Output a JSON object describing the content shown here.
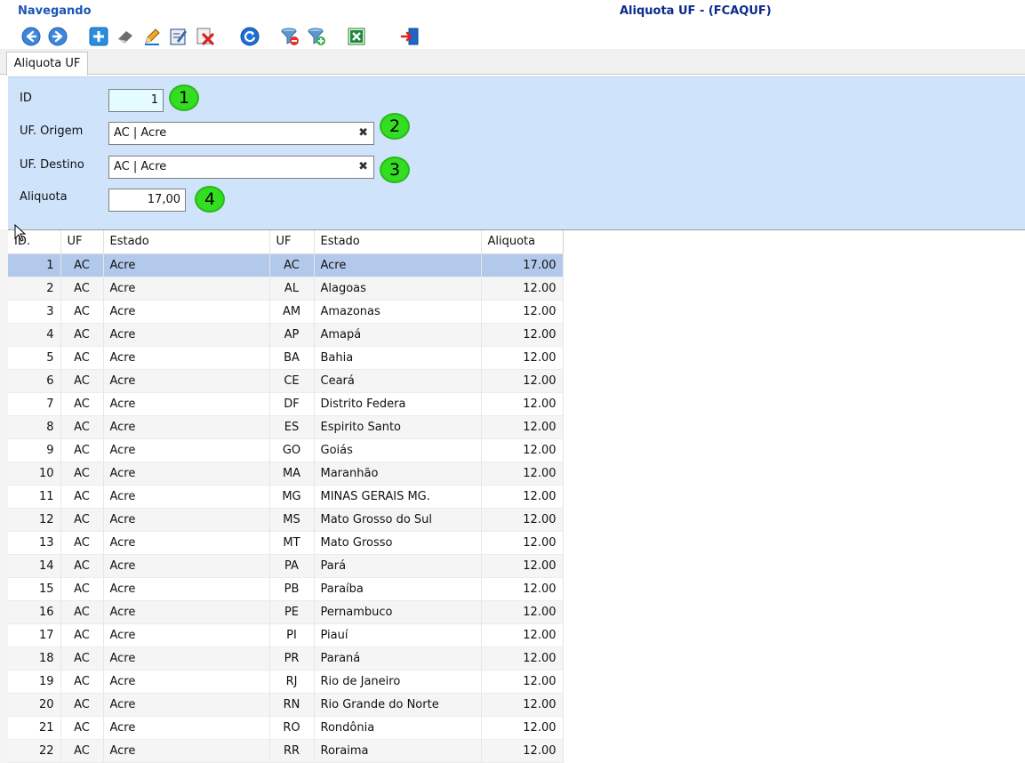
{
  "header": {
    "status": "Navegando",
    "title": "Aliquota UF - (FCAQUF)"
  },
  "toolbar": {
    "buttons": [
      {
        "icon": "arrow-left-icon"
      },
      {
        "icon": "arrow-right-icon"
      },
      {
        "icon": "add-icon"
      },
      {
        "icon": "eraser-icon"
      },
      {
        "icon": "pencil-icon"
      },
      {
        "icon": "edit-document-icon"
      },
      {
        "icon": "delete-icon"
      },
      {
        "icon": "refresh-icon"
      },
      {
        "icon": "filter-remove-icon"
      },
      {
        "icon": "filter-add-icon"
      },
      {
        "icon": "excel-icon"
      },
      {
        "icon": "exit-icon"
      }
    ]
  },
  "tabs": [
    {
      "label": "Aliquota UF"
    }
  ],
  "form": {
    "id_label": "ID",
    "id_value": "1",
    "uf_origem_label": "UF. Origem",
    "uf_origem_value": "AC | Acre",
    "uf_destino_label": "UF. Destino",
    "uf_destino_value": "AC | Acre",
    "aliquota_label": "Aliquota",
    "aliquota_value": "17,00",
    "badges": [
      "1",
      "2",
      "3",
      "4"
    ],
    "clear_symbol": "✖"
  },
  "grid": {
    "columns": [
      "ID.",
      "UF",
      "Estado",
      "UF",
      "Estado",
      "Aliquota"
    ],
    "rows": [
      [
        "1",
        "AC",
        "Acre",
        "AC",
        "Acre",
        "17.00"
      ],
      [
        "2",
        "AC",
        "Acre",
        "AL",
        "Alagoas",
        "12.00"
      ],
      [
        "3",
        "AC",
        "Acre",
        "AM",
        "Amazonas",
        "12.00"
      ],
      [
        "4",
        "AC",
        "Acre",
        "AP",
        "Amapá",
        "12.00"
      ],
      [
        "5",
        "AC",
        "Acre",
        "BA",
        "Bahia",
        "12.00"
      ],
      [
        "6",
        "AC",
        "Acre",
        "CE",
        "Ceará",
        "12.00"
      ],
      [
        "7",
        "AC",
        "Acre",
        "DF",
        "Distrito Federa",
        "12.00"
      ],
      [
        "8",
        "AC",
        "Acre",
        "ES",
        "Espirito Santo",
        "12.00"
      ],
      [
        "9",
        "AC",
        "Acre",
        "GO",
        "Goiás",
        "12.00"
      ],
      [
        "10",
        "AC",
        "Acre",
        "MA",
        "Maranhão",
        "12.00"
      ],
      [
        "11",
        "AC",
        "Acre",
        "MG",
        "MINAS GERAIS MG.",
        "12.00"
      ],
      [
        "12",
        "AC",
        "Acre",
        "MS",
        "Mato Grosso do Sul",
        "12.00"
      ],
      [
        "13",
        "AC",
        "Acre",
        "MT",
        "Mato Grosso",
        "12.00"
      ],
      [
        "14",
        "AC",
        "Acre",
        "PA",
        "Pará",
        "12.00"
      ],
      [
        "15",
        "AC",
        "Acre",
        "PB",
        "Paraíba",
        "12.00"
      ],
      [
        "16",
        "AC",
        "Acre",
        "PE",
        "Pernambuco",
        "12.00"
      ],
      [
        "17",
        "AC",
        "Acre",
        "PI",
        "Piauí",
        "12.00"
      ],
      [
        "18",
        "AC",
        "Acre",
        "PR",
        "Paraná",
        "12.00"
      ],
      [
        "19",
        "AC",
        "Acre",
        "RJ",
        "Rio de Janeiro",
        "12.00"
      ],
      [
        "20",
        "AC",
        "Acre",
        "RN",
        "Rio Grande do Norte",
        "12.00"
      ],
      [
        "21",
        "AC",
        "Acre",
        "RO",
        "Rondônia",
        "12.00"
      ],
      [
        "22",
        "AC",
        "Acre",
        "RR",
        "Roraima",
        "12.00"
      ]
    ],
    "selected_row": 0
  },
  "colors": {
    "status": "#1c55b4",
    "title": "#0b2a8a",
    "form_bg": "#cfe3fb",
    "selected_row": "#b3c9ec",
    "badge": "#33dd22"
  }
}
